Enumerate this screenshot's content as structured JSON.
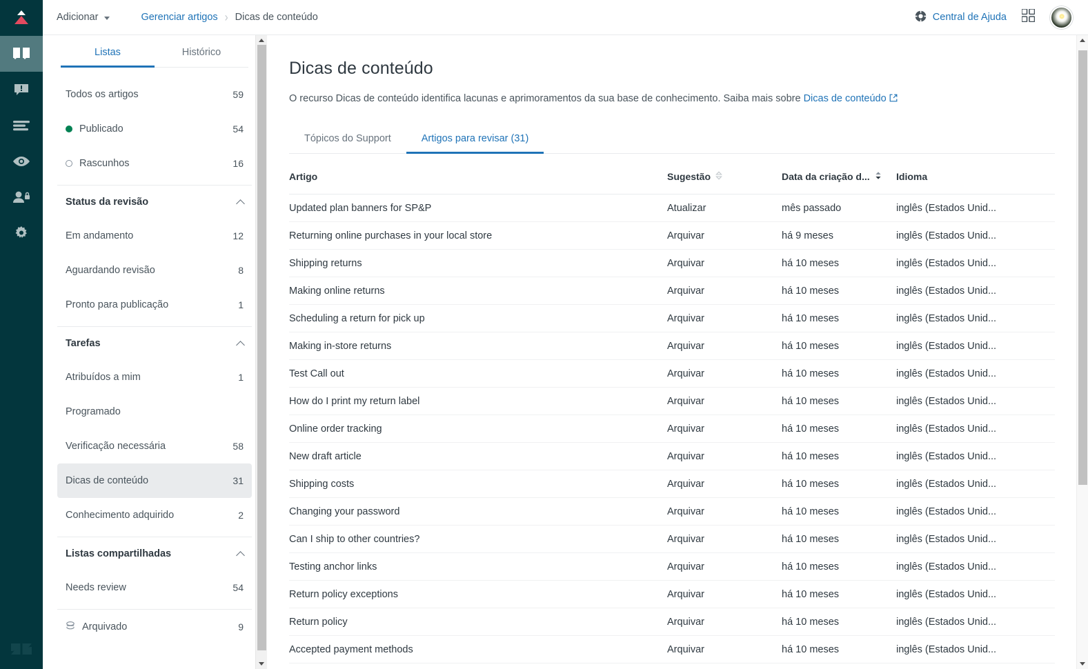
{
  "rail": {
    "logo_name": "zendesk-guide-logo",
    "items": [
      {
        "name": "articles-icon",
        "active": true
      },
      {
        "name": "announcements-icon",
        "active": false
      },
      {
        "name": "content-blocks-icon",
        "active": false
      },
      {
        "name": "preview-icon",
        "active": false
      },
      {
        "name": "user-permissions-icon",
        "active": false
      },
      {
        "name": "settings-gear-icon",
        "active": false
      }
    ],
    "footer_logo_name": "zendesk-logo"
  },
  "topbar": {
    "add_label": "Adicionar",
    "breadcrumb": {
      "parent": "Gerenciar artigos",
      "current": "Dicas de conteúdo",
      "separator": "›"
    },
    "help_label": "Central de Ajuda",
    "products_icon": "apps-grid-icon",
    "avatar_name": "user-avatar"
  },
  "sidebar": {
    "tabs": [
      {
        "label": "Listas",
        "active": true
      },
      {
        "label": "Histórico",
        "active": false
      }
    ],
    "top_items": [
      {
        "label": "Todos os artigos",
        "count": "59",
        "marker": "none"
      },
      {
        "label": "Publicado",
        "count": "54",
        "marker": "filled"
      },
      {
        "label": "Rascunhos",
        "count": "16",
        "marker": "open"
      }
    ],
    "groups": [
      {
        "title": "Status da revisão",
        "items": [
          {
            "label": "Em andamento",
            "count": "12"
          },
          {
            "label": "Aguardando revisão",
            "count": "8"
          },
          {
            "label": "Pronto para publicação",
            "count": "1"
          }
        ]
      },
      {
        "title": "Tarefas",
        "items": [
          {
            "label": "Atribuídos a mim",
            "count": "1"
          },
          {
            "label": "Programado",
            "count": ""
          },
          {
            "label": "Verificação necessária",
            "count": "58"
          },
          {
            "label": "Dicas de conteúdo",
            "count": "31",
            "selected": true
          },
          {
            "label": "Conhecimento adquirido",
            "count": "2"
          }
        ]
      },
      {
        "title": "Listas compartilhadas",
        "items": [
          {
            "label": "Needs review",
            "count": "54"
          }
        ]
      }
    ],
    "archived": {
      "label": "Arquivado",
      "count": "9",
      "icon": "archive-icon"
    }
  },
  "main": {
    "title": "Dicas de conteúdo",
    "description_before": "O recurso Dicas de conteúdo identifica lacunas e aprimoramentos da sua base de conhecimento. Saiba mais sobre ",
    "description_link": "Dicas de conteúdo",
    "tabs": [
      {
        "label": "Tópicos do Support",
        "active": false
      },
      {
        "label": "Artigos para revisar (31)",
        "active": true
      }
    ],
    "table": {
      "columns": [
        {
          "label": "Artigo",
          "sortable": false,
          "sort": "none"
        },
        {
          "label": "Sugestão",
          "sortable": true,
          "sort": "none"
        },
        {
          "label": "Data da criação d...",
          "sortable": true,
          "sort": "desc"
        },
        {
          "label": "Idioma",
          "sortable": false,
          "sort": "none"
        }
      ],
      "rows": [
        {
          "artigo": "Updated plan banners for SP&P",
          "sugestao": "Atualizar",
          "data": "mês passado",
          "idioma": "inglês (Estados Unid..."
        },
        {
          "artigo": "Returning online purchases in your local store",
          "sugestao": "Arquivar",
          "data": "há 9 meses",
          "idioma": "inglês (Estados Unid..."
        },
        {
          "artigo": "Shipping returns",
          "sugestao": "Arquivar",
          "data": "há 10 meses",
          "idioma": "inglês (Estados Unid..."
        },
        {
          "artigo": "Making online returns",
          "sugestao": "Arquivar",
          "data": "há 10 meses",
          "idioma": "inglês (Estados Unid..."
        },
        {
          "artigo": "Scheduling a return for pick up",
          "sugestao": "Arquivar",
          "data": "há 10 meses",
          "idioma": "inglês (Estados Unid..."
        },
        {
          "artigo": "Making in-store returns",
          "sugestao": "Arquivar",
          "data": "há 10 meses",
          "idioma": "inglês (Estados Unid..."
        },
        {
          "artigo": "Test Call out",
          "sugestao": "Arquivar",
          "data": "há 10 meses",
          "idioma": "inglês (Estados Unid..."
        },
        {
          "artigo": "How do I print my return label",
          "sugestao": "Arquivar",
          "data": "há 10 meses",
          "idioma": "inglês (Estados Unid..."
        },
        {
          "artigo": "Online order tracking",
          "sugestao": "Arquivar",
          "data": "há 10 meses",
          "idioma": "inglês (Estados Unid..."
        },
        {
          "artigo": "New draft article",
          "sugestao": "Arquivar",
          "data": "há 10 meses",
          "idioma": "inglês (Estados Unid..."
        },
        {
          "artigo": "Shipping costs",
          "sugestao": "Arquivar",
          "data": "há 10 meses",
          "idioma": "inglês (Estados Unid..."
        },
        {
          "artigo": "Changing your password",
          "sugestao": "Arquivar",
          "data": "há 10 meses",
          "idioma": "inglês (Estados Unid..."
        },
        {
          "artigo": "Can I ship to other countries?",
          "sugestao": "Arquivar",
          "data": "há 10 meses",
          "idioma": "inglês (Estados Unid..."
        },
        {
          "artigo": "Testing anchor links",
          "sugestao": "Arquivar",
          "data": "há 10 meses",
          "idioma": "inglês (Estados Unid..."
        },
        {
          "artigo": "Return policy exceptions",
          "sugestao": "Arquivar",
          "data": "há 10 meses",
          "idioma": "inglês (Estados Unid..."
        },
        {
          "artigo": "Return policy",
          "sugestao": "Arquivar",
          "data": "há 10 meses",
          "idioma": "inglês (Estados Unid..."
        },
        {
          "artigo": "Accepted payment methods",
          "sugestao": "Arquivar",
          "data": "há 10 meses",
          "idioma": "inglês (Estados Unid..."
        }
      ]
    }
  },
  "colors": {
    "rail_bg": "#03363d",
    "rail_active": "#527a7f",
    "accent_blue": "#1f73b7",
    "text_primary": "#2f3941",
    "text_secondary": "#68737d",
    "published_green": "#038153",
    "logo_red": "#e34a5f"
  }
}
